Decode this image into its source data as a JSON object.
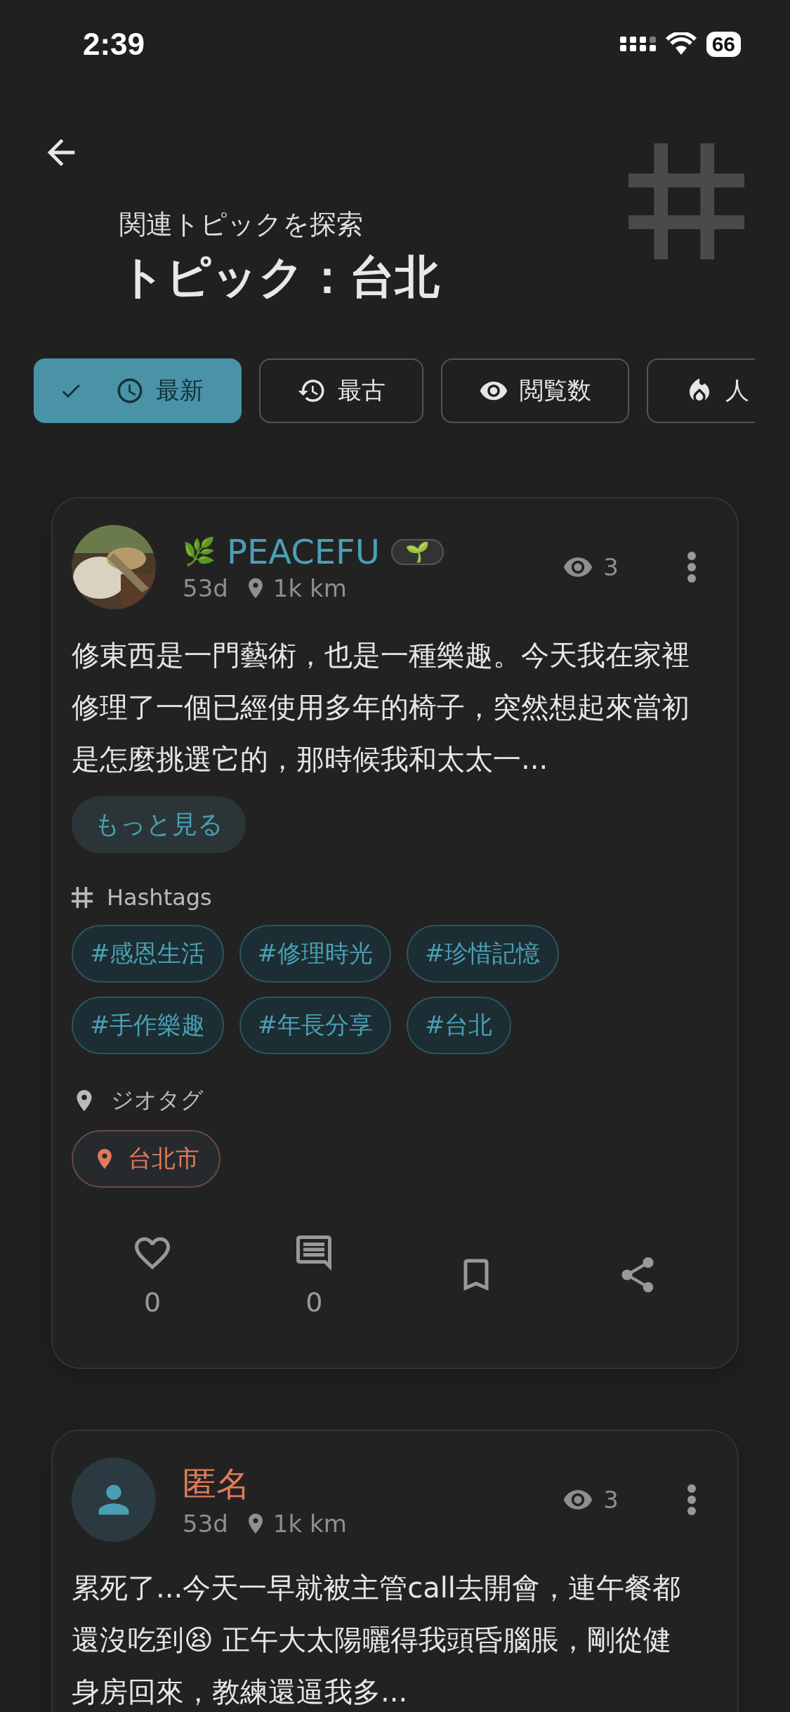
{
  "status_bar": {
    "time": "2:39",
    "battery": "66"
  },
  "header": {
    "subtitle": "関連トピックを探索",
    "title": "トピック：台北"
  },
  "sort_chips": [
    {
      "kind": "newest",
      "label": "最新",
      "selected": true
    },
    {
      "kind": "oldest",
      "label": "最古",
      "selected": false
    },
    {
      "kind": "views",
      "label": "閲覧数",
      "selected": false
    },
    {
      "kind": "popular",
      "label": "人",
      "selected": false
    }
  ],
  "posts": [
    {
      "avatar": {
        "kind": "picture"
      },
      "author": {
        "name": "PEACEFU",
        "color": "#4a9fb5",
        "emoji": "🌿",
        "badge": "🌱"
      },
      "age": "53d",
      "distance": "1k km",
      "views": "3",
      "text": "修東西是一門藝術，也是一種樂趣。今天我在家裡修理了一個已經使用多年的椅子，突然想起來當初是怎麼挑選它的，那時候我和太太一...",
      "more_button": "もっと見る",
      "hashtags_label": "Hashtags",
      "hashtags": [
        "#感恩生活",
        "#修理時光",
        "#珍惜記憶",
        "#手作樂趣",
        "#年長分享",
        "#台北"
      ],
      "geotags_label": "ジオタグ",
      "geotags": [
        "台北市"
      ],
      "actions": [
        {
          "kind": "like",
          "count": "0"
        },
        {
          "kind": "comment",
          "count": "0"
        },
        {
          "kind": "bookmark"
        },
        {
          "kind": "share"
        }
      ]
    },
    {
      "avatar": {
        "kind": "default"
      },
      "author": {
        "name": "匿名",
        "color": "#e07a5a"
      },
      "age": "53d",
      "distance": "1k km",
      "views": "3",
      "text": "累死了...今天一早就被主管call去開會，連午餐都還沒吃到😫  正午大太陽曬得我頭昏腦脹，剛從健身房回來，教練還逼我多..."
    }
  ]
}
